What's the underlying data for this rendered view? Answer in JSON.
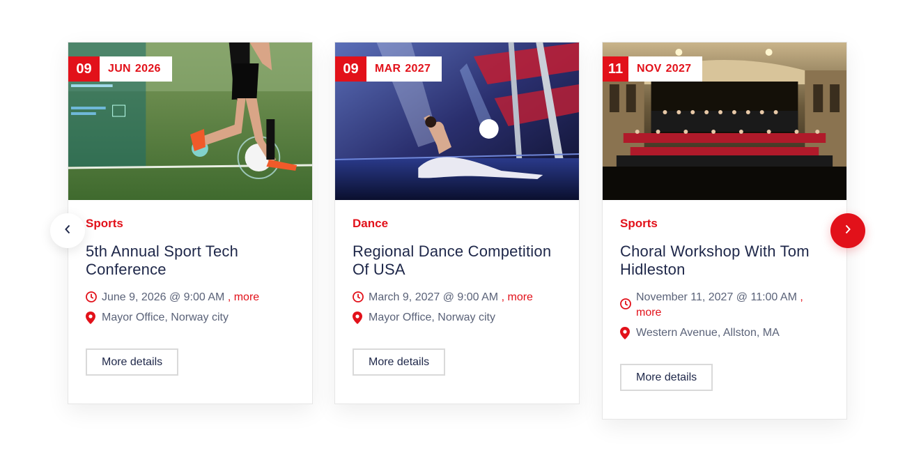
{
  "colors": {
    "accent": "#e2111a",
    "title": "#1e2749",
    "meta": "#5a6278"
  },
  "navigation": {
    "prev_icon": "chevron-left-icon",
    "next_icon": "chevron-right-icon"
  },
  "events": [
    {
      "day": "09",
      "month": "JUN",
      "year": "2026",
      "category": "Sports",
      "title": "5th Annual Sport Tech Conference",
      "time": "June 9, 2026 @ 9:00 AM",
      "separator": ",",
      "more": "more",
      "location": "Mayor Office, Norway city",
      "button": "More details",
      "image": "soccer player kicking ball with tech overlay"
    },
    {
      "day": "09",
      "month": "MAR",
      "year": "2027",
      "category": "Dance",
      "title": "Regional Dance Competition Of USA",
      "time": "March 9, 2027 @ 9:00 AM",
      "separator": ",",
      "more": "more",
      "location": "Mayor Office, Norway city",
      "button": "More details",
      "image": "dancer performing split on stage"
    },
    {
      "day": "11",
      "month": "NOV",
      "year": "2027",
      "category": "Sports",
      "title": "Choral Workshop With Tom Hidleston",
      "time": "November 11, 2027 @ 11:00 AM",
      "separator": ",",
      "more": "more",
      "location": "Western Avenue, Allston, MA",
      "button": "More details",
      "image": "choir and orchestra in concert hall"
    }
  ]
}
